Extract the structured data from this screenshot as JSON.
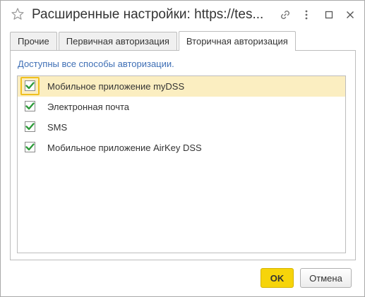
{
  "window": {
    "title": "Расширенные настройки: https://tes...",
    "icons": [
      "star-icon",
      "link-icon",
      "more-icon",
      "maximize-icon",
      "close-icon"
    ]
  },
  "tabs": [
    {
      "label": "Прочие",
      "active": false
    },
    {
      "label": "Первичная авторизация",
      "active": false
    },
    {
      "label": "Вторичная авторизация",
      "active": true
    }
  ],
  "panel": {
    "hint": "Доступны все способы авторизации.",
    "items": [
      {
        "label": "Мобильное приложение myDSS",
        "checked": true,
        "selected": true
      },
      {
        "label": "Электронная почта",
        "checked": true,
        "selected": false
      },
      {
        "label": "SMS",
        "checked": true,
        "selected": false
      },
      {
        "label": "Мобильное приложение AirKey DSS",
        "checked": true,
        "selected": false
      }
    ]
  },
  "buttons": {
    "ok_label": "OK",
    "cancel_label": "Отмена"
  },
  "colors": {
    "accent": "#f6d40a",
    "selection": "#fbeec1",
    "check": "#2e9b3a",
    "hint_text": "#3f6fb5"
  }
}
